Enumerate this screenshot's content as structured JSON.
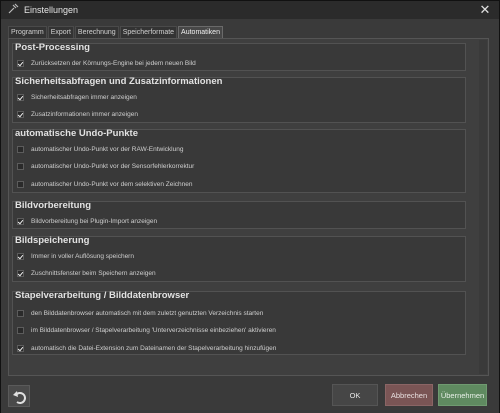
{
  "window": {
    "title": "Einstellungen",
    "close_glyph": "✕"
  },
  "tabs": [
    {
      "label": "Programm",
      "active": false
    },
    {
      "label": "Export",
      "active": false
    },
    {
      "label": "Berechnung",
      "active": false
    },
    {
      "label": "Speicherformate",
      "active": false
    },
    {
      "label": "Automatiken",
      "active": true
    }
  ],
  "groups": [
    {
      "title": "Post-Processing",
      "options": [
        {
          "label": "Zurücksetzen der Körnungs-Engine bei jedem neuen Bild",
          "checked": true
        }
      ]
    },
    {
      "title": "Sicherheitsabfragen und Zusatzinformationen",
      "options": [
        {
          "label": "Sicherheitsabfragen immer anzeigen",
          "checked": true
        },
        {
          "label": "Zusatzinformationen immer anzeigen",
          "checked": true
        }
      ]
    },
    {
      "title": "automatische Undo-Punkte",
      "options": [
        {
          "label": "automatischer Undo-Punkt vor der RAW-Entwicklung",
          "checked": false
        },
        {
          "label": "automatischer Undo-Punkt vor der Sensorfehlerkorrektur",
          "checked": false
        },
        {
          "label": "automatischer Undo-Punkt vor dem selektiven Zeichnen",
          "checked": false
        }
      ]
    },
    {
      "title": "Bildvorbereitung",
      "options": [
        {
          "label": "Bildvorbereitung bei Plugin-Import anzeigen",
          "checked": true
        }
      ]
    },
    {
      "title": "Bildspeicherung",
      "options": [
        {
          "label": "Immer in voller Auflösung speichern",
          "checked": true
        },
        {
          "label": "Zuschnittsfenster beim Speichern anzeigen",
          "checked": true
        }
      ]
    },
    {
      "title": "Stapelverarbeitung / Bilddatenbrowser",
      "options": [
        {
          "label": "den Bilddatenbrowser automatisch mit dem zuletzt genutzten Verzeichnis starten",
          "checked": false
        },
        {
          "label": "im Bilddatenbrowser / Stapelverarbeitung 'Unterverzeichnisse einbeziehen' aktivieren",
          "checked": false
        },
        {
          "label": "automatisch die Datei-Extension zum Dateinamen der Stapelverarbeitung hinzufügen",
          "checked": true
        }
      ]
    }
  ],
  "footer": {
    "ok_label": "OK",
    "cancel_label": "Abbrechen",
    "apply_label": "Übernehmen"
  },
  "colors": {
    "cancel": "#7a5555",
    "apply": "#5f8a60"
  }
}
